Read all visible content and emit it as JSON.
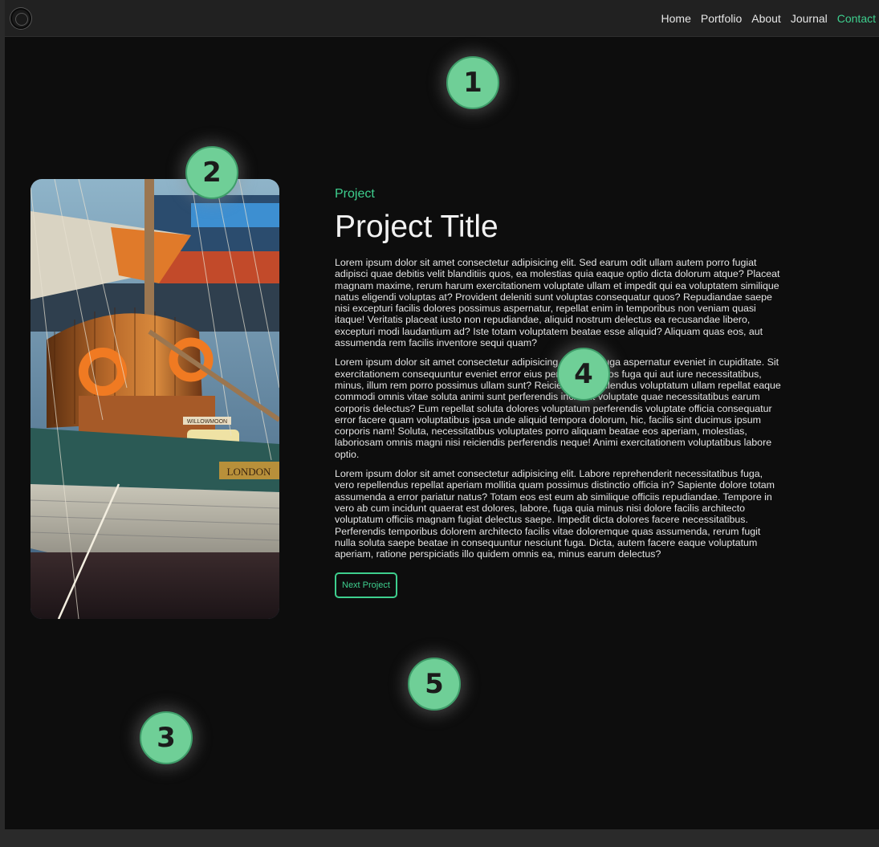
{
  "nav": {
    "links": [
      "Home",
      "Portfolio",
      "About",
      "Journal",
      "Contact"
    ],
    "active": "Contact"
  },
  "project": {
    "eyebrow": "Project",
    "title": "Project Title",
    "paragraphs": [
      "Lorem ipsum dolor sit amet consectetur adipisicing elit. Sed earum odit ullam autem porro fugiat adipisci quae debitis velit blanditiis quos, ea molestias quia eaque optio dicta dolorum atque? Placeat magnam maxime, rerum harum exercitationem voluptate ullam et impedit qui ea voluptatem similique natus eligendi voluptas at? Provident deleniti sunt voluptas consequatur quos? Repudiandae saepe nisi excepturi facilis dolores possimus aspernatur, repellat enim in temporibus non veniam quasi itaque! Veritatis placeat iusto non repudiandae, aliquid nostrum delectus ea recusandae libero, excepturi modi laudantium ad? Iste totam voluptatem beatae esse aliquid? Aliquam quas eos, aut assumenda rem facilis inventore sequi quam?",
      "Lorem ipsum dolor sit amet consectetur adipisicing elit. Nihil fuga aspernatur eveniet in cupiditate. Sit exercitationem consequuntur eveniet error eius perferendis quos fuga qui aut iure necessitatibus, minus, illum rem porro possimus ullam sunt? Reiciendis, repellendus voluptatum ullam repellat eaque commodi omnis vitae soluta animi sunt perferendis incidunt voluptate quae necessitatibus earum corporis delectus? Eum repellat soluta dolores voluptatum perferendis voluptate officia consequatur error facere quam voluptatibus ipsa unde aliquid tempora dolorum, hic, facilis sint ducimus ipsum corporis nam! Soluta, necessitatibus voluptates porro aliquam beatae eos aperiam, molestias, laboriosam omnis magni nisi reiciendis perferendis neque! Animi exercitationem voluptatibus labore optio.",
      "Lorem ipsum dolor sit amet consectetur adipisicing elit. Labore reprehenderit necessitatibus fuga, vero repellendus repellat aperiam mollitia quam possimus distinctio officia in? Sapiente dolore totam assumenda a error pariatur natus? Totam eos est eum ab similique officiis repudiandae. Tempore in vero ab cum incidunt quaerat est dolores, labore, fuga quia minus nisi dolore facilis architecto voluptatum officiis magnam fugiat delectus saepe. Impedit dicta dolores facere necessitatibus. Perferendis temporibus dolorem architecto facilis vitae doloremque quas assumenda, rerum fugit nulla soluta saepe beatae in consequuntur nesciunt fuga. Dicta, autem facere eaque voluptatum aperiam, ratione perspiciatis illo quidem omnis ea, minus earum delectus?"
    ],
    "button_label": "Next Project"
  },
  "photo": {
    "boat_name": "WILLOWMOON",
    "hull_name": "LONDON"
  },
  "annotations": [
    "1",
    "2",
    "3",
    "4",
    "5"
  ],
  "colors": {
    "accent": "#3ecf8e",
    "background": "#0d0d0d",
    "navbar": "#212121",
    "badge": "#6fcf97"
  }
}
